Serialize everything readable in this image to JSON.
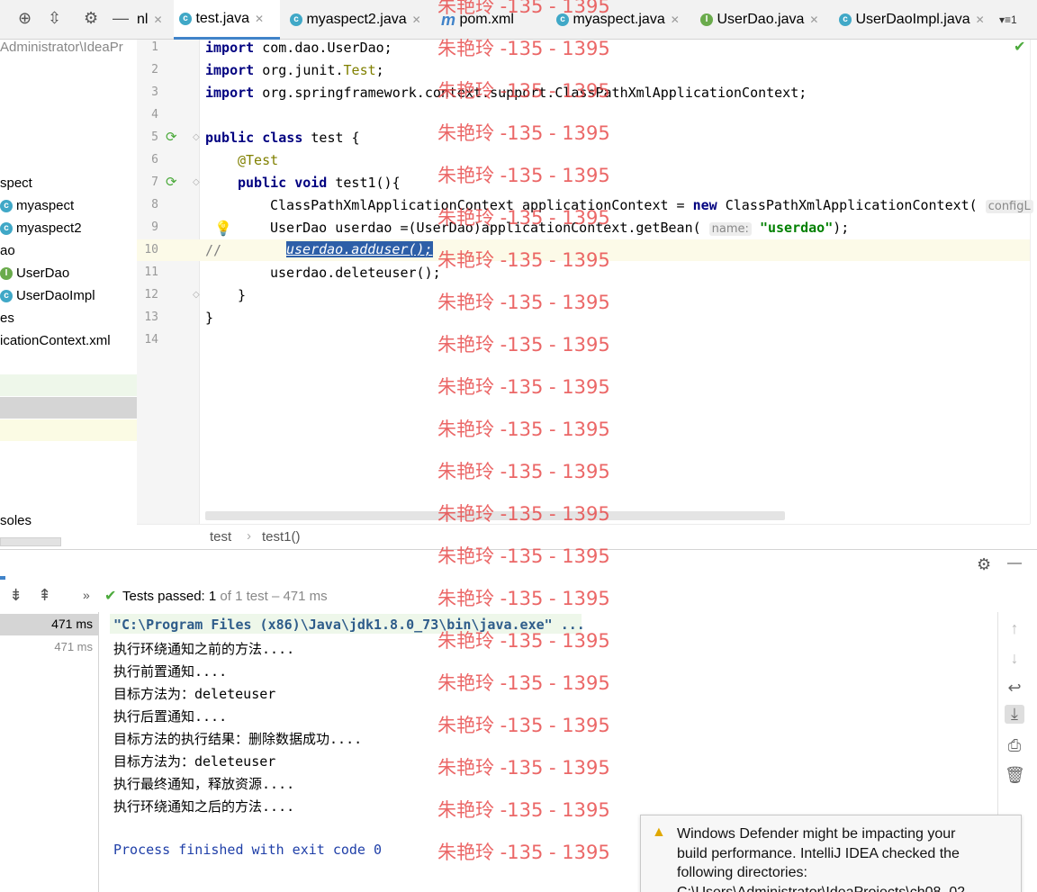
{
  "tabs": [
    {
      "label": "nl",
      "icon": "none"
    },
    {
      "label": "test.java",
      "icon": "class-icon",
      "active": true
    },
    {
      "label": "myaspect2.java",
      "icon": "class-icon"
    },
    {
      "label": "pom.xml",
      "icon": "maven-icon"
    },
    {
      "label": "myaspect.java",
      "icon": "class-icon"
    },
    {
      "label": "UserDao.java",
      "icon": "interface-icon"
    },
    {
      "label": "UserDaoImpl.java",
      "icon": "class-icon"
    }
  ],
  "tab_overflow": "▾≡1",
  "project": {
    "path": "Administrator\\IdeaPr",
    "items": [
      {
        "label": "spect",
        "icon": "none"
      },
      {
        "label": "myaspect",
        "icon": "class-icon"
      },
      {
        "label": "myaspect2",
        "icon": "class-icon"
      },
      {
        "label": "ao",
        "icon": "none"
      },
      {
        "label": "UserDao",
        "icon": "interface-icon"
      },
      {
        "label": "UserDaoImpl",
        "icon": "class-icon"
      },
      {
        "label": "es",
        "icon": "none"
      },
      {
        "label": "icationContext.xml",
        "icon": "none"
      },
      {
        "label": "soles",
        "icon": "none"
      }
    ]
  },
  "editor": {
    "line_numbers": [
      "1",
      "2",
      "3",
      "4",
      "5",
      "6",
      "7",
      "8",
      "9",
      "10",
      "11",
      "12",
      "13",
      "14"
    ],
    "lines": {
      "l1_kw": "import",
      "l1_rest": " com.dao.UserDao;",
      "l2_kw": "import",
      "l2_rest": " org.junit.",
      "l2_ann": "Test",
      "l2_end": ";",
      "l3_kw": "import",
      "l3_rest": " org.springframework.context.support.ClassPathXmlApplicationContext;",
      "l5_kw1": "public",
      "l5_kw2": "class",
      "l5_rest": " test {",
      "l6_ann": "@Test",
      "l7_kw1": "public",
      "l7_kw2": "void",
      "l7_rest": " test1(){",
      "l8_a": "ClassPathXmlApplicationContext applicationContext = ",
      "l8_kw": "new",
      "l8_b": " ClassPathXmlApplicationContext( ",
      "l8_hint": "configL",
      "l9_a": "UserDao userdao =(UserDao)applicationContext.getBean( ",
      "l9_hint": "name:",
      "l9_str": "\"userdao\"",
      "l9_end": ");",
      "l10_cmt": "//",
      "l10_sel": "userdao.adduser();",
      "l11": "userdao.deleteuser();",
      "l12": "}",
      "l13": "}"
    }
  },
  "breadcrumb": {
    "class": "test",
    "method": "test1()"
  },
  "run": {
    "status_label": "Tests passed:",
    "status_count": "1",
    "status_rest": "of 1 test – 471 ms",
    "tree_time_1": "471 ms",
    "tree_time_2": "471 ms",
    "console": [
      "\"C:\\Program Files (x86)\\Java\\jdk1.8.0_73\\bin\\java.exe\" ...",
      "执行环绕通知之前的方法....",
      "执行前置通知....",
      "目标方法为：deleteuser",
      "执行后置通知....",
      "目标方法的执行结果：删除数据成功....",
      "目标方法为：deleteuser",
      "执行最终通知，释放资源....",
      "执行环绕通知之后的方法....",
      "",
      "Process finished with exit code 0"
    ]
  },
  "notification": {
    "text_1": "Windows Defender might be impacting your",
    "text_2": "build performance. IntelliJ IDEA checked the",
    "text_3": "following directories:",
    "text_4": "C:\\Users\\Administrator\\IdeaProjects\\ch08_02"
  },
  "watermark": "朱艳玲 -135 - 1395",
  "colors": {
    "keyword": "#000080",
    "string": "#008000",
    "annotation": "#808000",
    "watermark": "#e64646",
    "selection": "#2d5fa8"
  }
}
